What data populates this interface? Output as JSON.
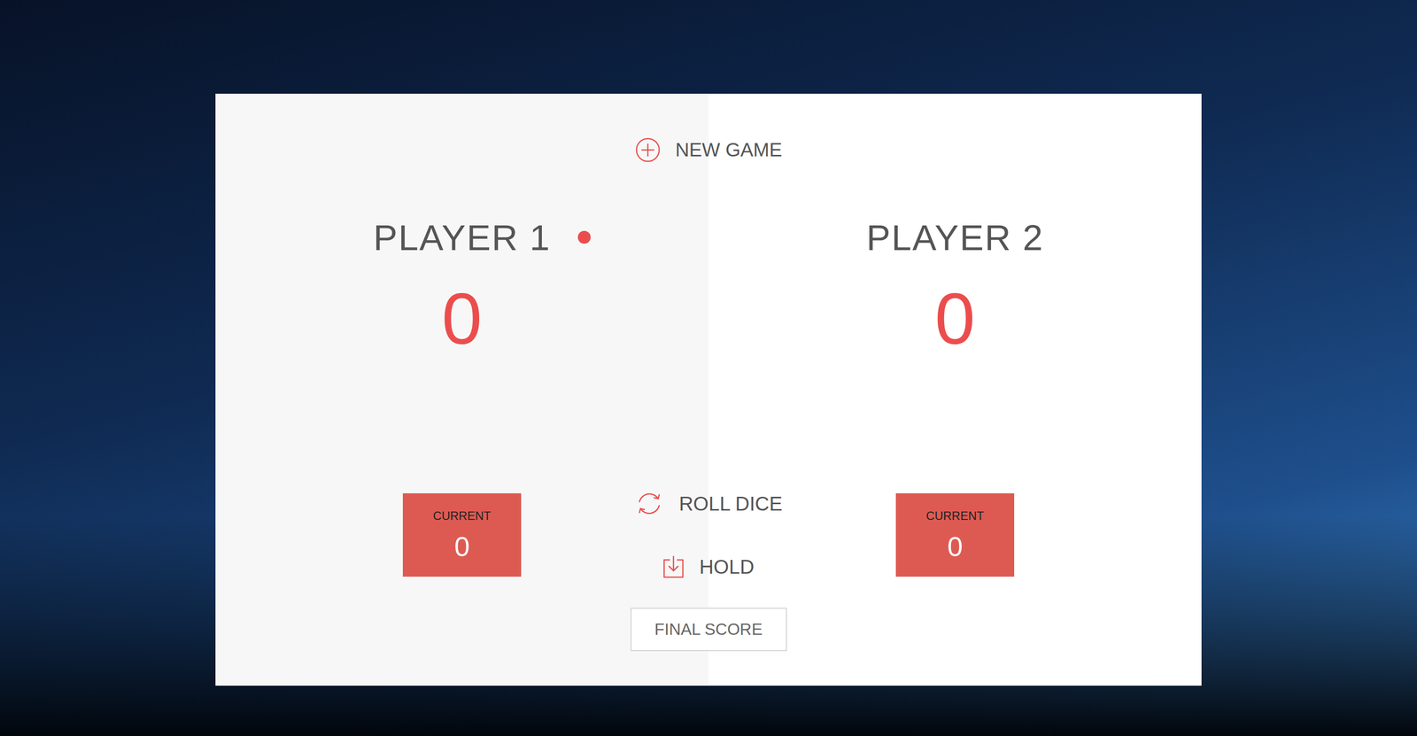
{
  "new_game": "NEW GAME",
  "players": [
    {
      "name": "PLAYER 1",
      "score": "0",
      "current_label": "CURRENT",
      "current": "0",
      "selected": true
    },
    {
      "name": "PLAYER 2",
      "score": "0",
      "current_label": "CURRENT",
      "current": "0",
      "selected": false
    }
  ],
  "buttons": {
    "roll": "ROLL DICE",
    "hold": "HOLD"
  },
  "final_score": {
    "placeholder": "FINAL SCORE"
  }
}
